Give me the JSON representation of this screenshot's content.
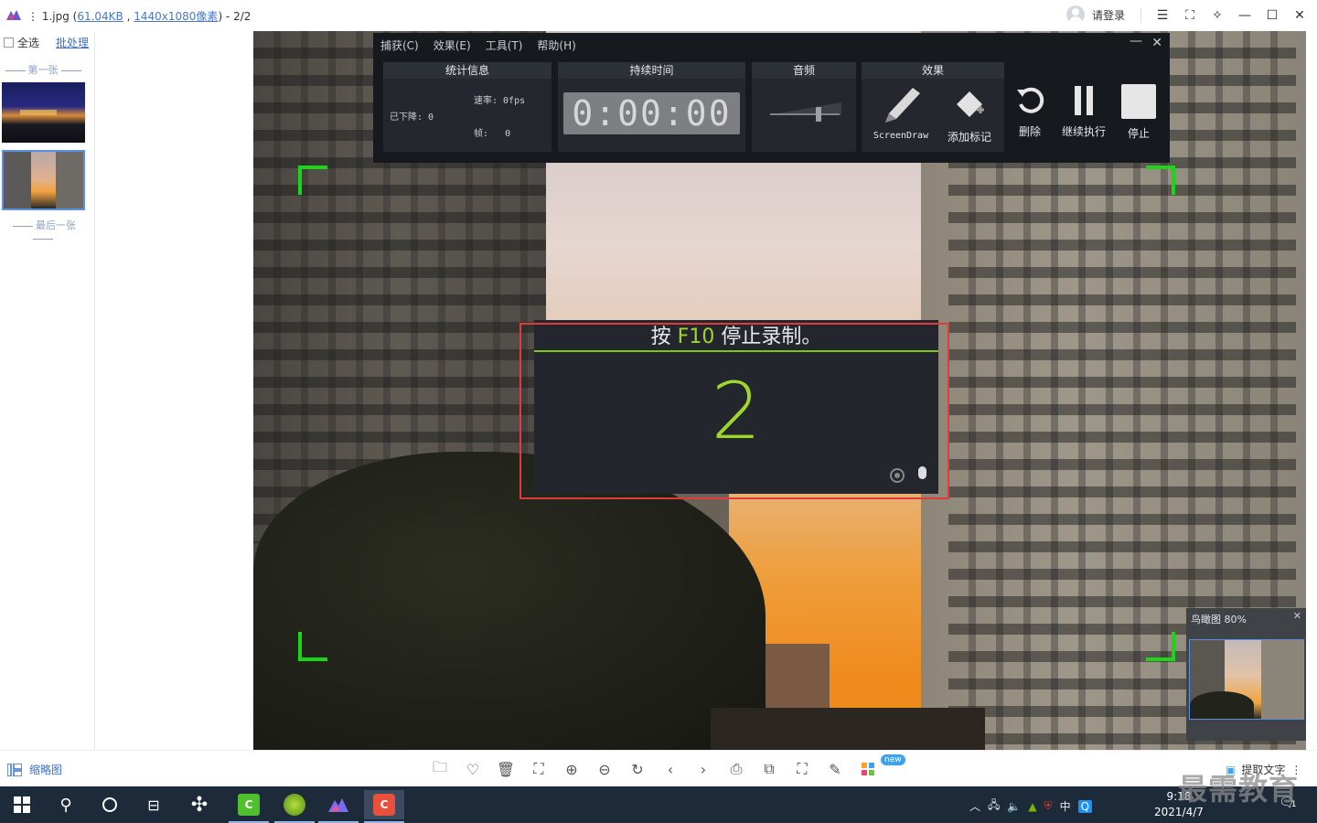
{
  "titlebar": {
    "prefix": "⋮ 1.jpg (",
    "file_size": "61.04KB",
    "comma": " , ",
    "dimensions": "1440x1080像素",
    "suffix": ") - 2/2",
    "login": "请登录"
  },
  "sidebar": {
    "select_all": "全选",
    "batch": "批处理",
    "first_label": "第一张",
    "last_label": "最后一张"
  },
  "recorder": {
    "menu": [
      "捕获(C)",
      "效果(E)",
      "工具(T)",
      "帮助(H)"
    ],
    "panels": {
      "stats_title": "统计信息",
      "rate_label": "速率: 0fps",
      "dropped_label": "已下降: 0",
      "frames_label": "帧:   0",
      "duration_title": "持续时间",
      "timer": "0:00:00",
      "audio_title": "音频",
      "effects_title": "效果",
      "screendraw": "ScreenDraw",
      "add_marker": "添加标记"
    },
    "buttons": {
      "delete": "删除",
      "resume": "继续执行",
      "stop": "停止"
    },
    "audio_level": 0.7
  },
  "countdown": {
    "prefix": "按 ",
    "key": "F10",
    "suffix": " 停止录制。",
    "number": "2"
  },
  "minimap": {
    "title": "鸟瞰图 80%"
  },
  "bottom": {
    "thumb_label": "缩略图",
    "new_badge": "new",
    "extract_text": "提取文字"
  },
  "taskbar": {
    "ime": "中",
    "time": "9:18",
    "date": "2021/4/7",
    "notification_count": "1"
  },
  "watermark": "最需教育"
}
